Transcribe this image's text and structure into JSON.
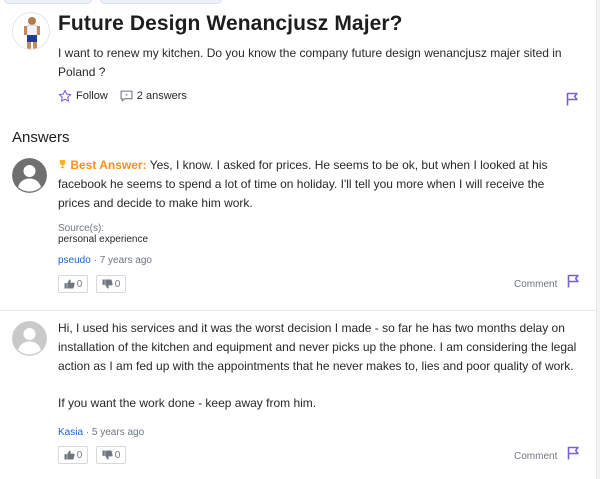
{
  "question": {
    "title": "Future Design Wenancjusz Majer?",
    "body": "I want to renew my kitchen. Do you know the company future design wenancjusz majer sited in Poland ?",
    "follow_label": "Follow",
    "answers_count_label": "2 answers",
    "follow_icon": "star-outline-icon",
    "answers_icon": "speech-bubble-icon"
  },
  "answers_heading": "Answers",
  "answers": [
    {
      "best_answer_label": "Best Answer:",
      "text": "Yes, I know. I asked for prices. He seems to be ok, but when I looked at his facebook he seems to spend a lot of time on holiday. I'll tell you more when I will receive the prices and decide to make him work.",
      "source_label": "Source(s):",
      "source_value": "personal experience",
      "author": "pseudo",
      "time": "7 years ago",
      "thumbs_up": "0",
      "thumbs_down": "0",
      "comment_label": "Comment"
    },
    {
      "text_p1": "Hi, I used his services and it was the worst decision I made - so far he has two months delay on installation of the kitchen and equipment and never picks up the phone. I am considering the legal action as I am fed up with the appointments that he never makes to, lies and poor quality of work.",
      "text_p2": "If you want the work done - keep away from him.",
      "author": "Kasia",
      "time": "5 years ago",
      "thumbs_up": "0",
      "thumbs_down": "0",
      "comment_label": "Comment"
    }
  ],
  "colors": {
    "accent": "#7b5fd6",
    "best_answer": "#ff8f1c",
    "link": "#1a63d6",
    "meta": "#6e7780"
  }
}
